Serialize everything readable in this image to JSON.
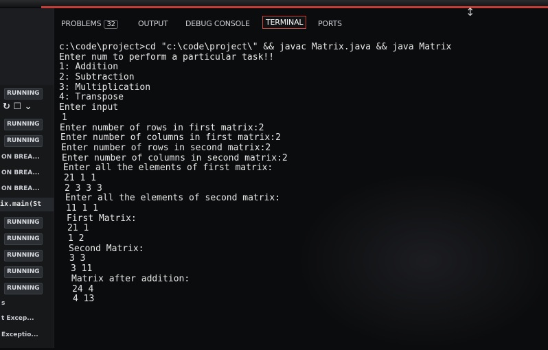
{
  "panel": {
    "tabs": [
      {
        "label": "PROBLEMS",
        "count": "32"
      },
      {
        "label": "OUTPUT"
      },
      {
        "label": "DEBUG CONSOLE"
      },
      {
        "label": "TERMINAL"
      },
      {
        "label": "PORTS"
      }
    ],
    "active_tab": "TERMINAL"
  },
  "sidebar": {
    "items": [
      {
        "text": "RUNNING",
        "style": "badge"
      },
      {
        "text": "↻ ☐ ⌄",
        "style": "ctrl"
      },
      {
        "text": "RUNNING",
        "style": "badge"
      },
      {
        "text": "RUNNING",
        "style": "badge"
      },
      {
        "text": "ON BREA...",
        "style": "plain"
      },
      {
        "text": "ON BREA...",
        "style": "plain"
      },
      {
        "text": "ON BREA...",
        "style": "plain"
      },
      {
        "text": "ix.main(St",
        "style": "mono"
      },
      {
        "text": "RUNNING",
        "style": "badge"
      },
      {
        "text": "RUNNING",
        "style": "badge"
      },
      {
        "text": "RUNNING",
        "style": "badge"
      },
      {
        "text": "RUNNING",
        "style": "badge"
      },
      {
        "text": "RUNNING",
        "style": "badge"
      },
      {
        "text": "s",
        "style": "plain"
      },
      {
        "text": "t Excep...",
        "style": "plain"
      },
      {
        "text": "Exceptio...",
        "style": "plain"
      }
    ]
  },
  "terminal": {
    "lines": [
      "c:\\code\\project>cd \"c:\\code\\project\\\" && javac Matrix.java && java Matrix",
      "Enter num to perform a particular task!!",
      "1: Addition",
      "2: Subtraction",
      "3: Multiplication",
      "4: Transpose",
      "Enter input",
      "1",
      "Enter number of rows in first matrix:2",
      "Enter number of columns in first matrix:2",
      "Enter number of rows in second matrix:2",
      "Enter number of columns in second matrix:2",
      "Enter all the elements of first matrix:",
      "21 1 1",
      "2 3 3 3",
      "Enter all the elements of second matrix:",
      "11 1 1",
      "First Matrix:",
      "21 1",
      "1 2",
      "Second Matrix:",
      "3 3",
      "3 11",
      "Matrix after addition:",
      "24 4",
      "4 13"
    ]
  }
}
